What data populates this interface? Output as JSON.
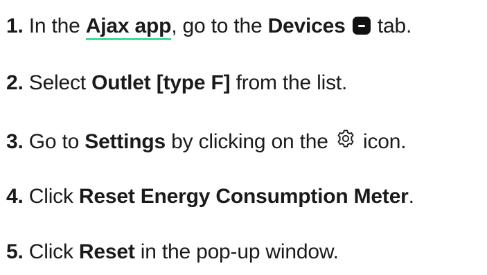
{
  "steps": [
    {
      "number": "1.",
      "part1": "In the",
      "link": "Ajax app",
      "part2": ", go to the",
      "bold": "Devices",
      "icon": "devices-icon",
      "part3": "tab."
    },
    {
      "number": "2.",
      "part1": "Select",
      "bold": "Outlet [type F]",
      "part2": "from the list."
    },
    {
      "number": "3.",
      "part1": "Go to",
      "bold": "Settings",
      "part2": "by clicking on the",
      "icon": "gear-icon",
      "part3": "icon."
    },
    {
      "number": "4.",
      "part1": "Click",
      "bold": "Reset Energy Consumption Meter",
      "part2": "."
    },
    {
      "number": "5.",
      "part1": "Click",
      "bold": "Reset",
      "part2": "in the pop-up window."
    }
  ],
  "colors": {
    "text": "#1a1a1a",
    "link_underline": "#3ddc97",
    "icon_fill": "#111111"
  }
}
